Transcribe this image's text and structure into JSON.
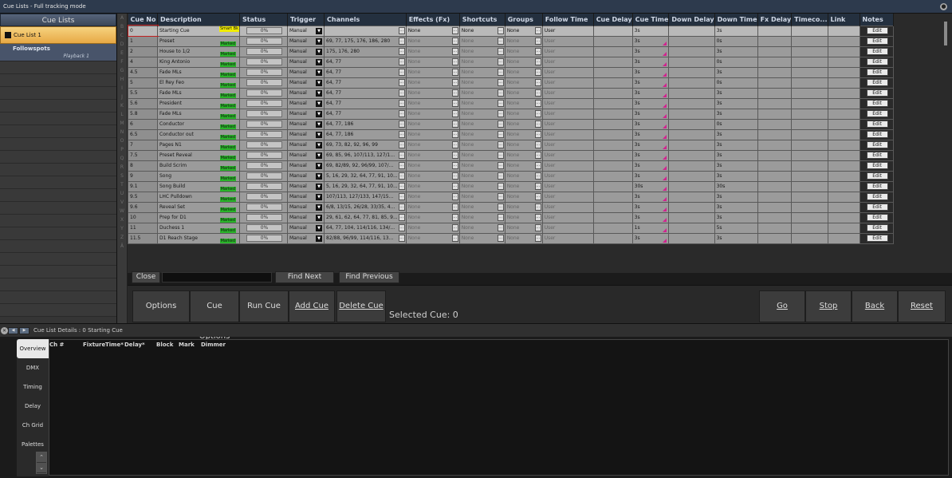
{
  "window": {
    "title": "Cue Lists - Full tracking mode"
  },
  "left": {
    "header": "Cue Lists",
    "items": [
      {
        "label": "Cue List 1"
      },
      {
        "label": "Followspots",
        "sub": "Playback 1"
      }
    ]
  },
  "alpha_letters": [
    "A",
    "B",
    "C",
    "D",
    "E",
    "F",
    "G",
    "H",
    "I",
    "J",
    "K",
    "L",
    "M",
    "N",
    "O",
    "P",
    "Q",
    "R",
    "S",
    "T",
    "U",
    "V",
    "W",
    "X",
    "Y",
    "Z",
    "Ä"
  ],
  "table": {
    "headers": [
      "Cue No",
      "Description",
      "Status",
      "Trigger",
      "Channels",
      "Effects (Fx)",
      "Shortcuts",
      "Groups",
      "Follow Time",
      "Cue Delay",
      "Cue Time",
      "Down Delay",
      "Down Time",
      "Fx Delay",
      "Timeco...",
      "Link",
      "Notes"
    ],
    "rows": [
      {
        "cue": "0",
        "desc": "Starting Cue",
        "badge": "Smart Bk",
        "status": "0%",
        "trigger": "Manual",
        "channels": "",
        "fx": "None",
        "shortcuts": "None",
        "groups": "None",
        "follow": "User",
        "cue_time": "3s",
        "down_time": "3s",
        "notes": "Edit"
      },
      {
        "cue": "1",
        "desc": "Preset",
        "badge": "Marked",
        "status": "0%",
        "trigger": "Manual",
        "channels": "69, 77, 175, 176, 186, 280",
        "fx": "None",
        "shortcuts": "None",
        "groups": "None",
        "follow": "User",
        "cue_time": "3s",
        "down_time": "0s",
        "notes": "Edit"
      },
      {
        "cue": "2",
        "desc": "House to 1/2",
        "badge": "Marked",
        "status": "0%",
        "trigger": "Manual",
        "channels": "175, 176, 280",
        "fx": "None",
        "shortcuts": "None",
        "groups": "None",
        "follow": "User",
        "cue_time": "3s",
        "down_time": "3s",
        "notes": "Edit"
      },
      {
        "cue": "4",
        "desc": "King Antonio",
        "badge": "Marked",
        "status": "0%",
        "trigger": "Manual",
        "channels": "64, 77",
        "fx": "None",
        "shortcuts": "None",
        "groups": "None",
        "follow": "User",
        "cue_time": "3s",
        "down_time": "0s",
        "notes": "Edit"
      },
      {
        "cue": "4.5",
        "desc": "Fade MLs",
        "badge": "Marked",
        "status": "0%",
        "trigger": "Manual",
        "channels": "64, 77",
        "fx": "None",
        "shortcuts": "None",
        "groups": "None",
        "follow": "User",
        "cue_time": "3s",
        "down_time": "3s",
        "notes": "Edit"
      },
      {
        "cue": "5",
        "desc": "El Rey Feo",
        "badge": "Marked",
        "status": "0%",
        "trigger": "Manual",
        "channels": "64, 77",
        "fx": "None",
        "shortcuts": "None",
        "groups": "None",
        "follow": "User",
        "cue_time": "3s",
        "down_time": "0s",
        "notes": "Edit"
      },
      {
        "cue": "5.5",
        "desc": "Fade MLs",
        "badge": "Marked",
        "status": "0%",
        "trigger": "Manual",
        "channels": "64, 77",
        "fx": "None",
        "shortcuts": "None",
        "groups": "None",
        "follow": "User",
        "cue_time": "3s",
        "down_time": "3s",
        "notes": "Edit"
      },
      {
        "cue": "5.6",
        "desc": "President",
        "badge": "Marked",
        "status": "0%",
        "trigger": "Manual",
        "channels": "64, 77",
        "fx": "None",
        "shortcuts": "None",
        "groups": "None",
        "follow": "User",
        "cue_time": "3s",
        "down_time": "3s",
        "notes": "Edit"
      },
      {
        "cue": "5.8",
        "desc": "Fade MLs",
        "badge": "Marked",
        "status": "0%",
        "trigger": "Manual",
        "channels": "64, 77",
        "fx": "None",
        "shortcuts": "None",
        "groups": "None",
        "follow": "User",
        "cue_time": "3s",
        "down_time": "3s",
        "notes": "Edit"
      },
      {
        "cue": "6",
        "desc": "Conductor",
        "badge": "Marked",
        "status": "0%",
        "trigger": "Manual",
        "channels": "64, 77, 186",
        "fx": "None",
        "shortcuts": "None",
        "groups": "None",
        "follow": "User",
        "cue_time": "3s",
        "down_time": "0s",
        "notes": "Edit"
      },
      {
        "cue": "6.5",
        "desc": "Conductor out",
        "badge": "Marked",
        "status": "0%",
        "trigger": "Manual",
        "channels": "64, 77, 186",
        "fx": "None",
        "shortcuts": "None",
        "groups": "None",
        "follow": "User",
        "cue_time": "3s",
        "down_time": "3s",
        "notes": "Edit"
      },
      {
        "cue": "7",
        "desc": "Pages N1",
        "badge": "Marked",
        "status": "0%",
        "trigger": "Manual",
        "channels": "69, 73, 82, 92, 96, 99",
        "fx": "None",
        "shortcuts": "None",
        "groups": "None",
        "follow": "User",
        "cue_time": "3s",
        "down_time": "3s",
        "notes": "Edit"
      },
      {
        "cue": "7.5",
        "desc": "Preset Reveal",
        "badge": "Marked",
        "status": "0%",
        "trigger": "Manual",
        "channels": "69, 85, 96, 107/113, 127/1...",
        "fx": "None",
        "shortcuts": "None",
        "groups": "None",
        "follow": "User",
        "cue_time": "3s",
        "down_time": "3s",
        "notes": "Edit"
      },
      {
        "cue": "8",
        "desc": "Build Scrim",
        "badge": "Marked",
        "status": "0%",
        "trigger": "Manual",
        "channels": "69, 82/89, 92, 96/99, 107/...",
        "fx": "None",
        "shortcuts": "None",
        "groups": "None",
        "follow": "User",
        "cue_time": "3s",
        "down_time": "3s",
        "notes": "Edit"
      },
      {
        "cue": "9",
        "desc": "Song",
        "badge": "Marked",
        "status": "0%",
        "trigger": "Manual",
        "channels": "5, 16, 29, 32, 64, 77, 91, 10...",
        "fx": "None",
        "shortcuts": "None",
        "groups": "None",
        "follow": "User",
        "cue_time": "3s",
        "down_time": "3s",
        "notes": "Edit"
      },
      {
        "cue": "9.1",
        "desc": "Song Build",
        "badge": "Marked",
        "status": "0%",
        "trigger": "Manual",
        "channels": "5, 16, 29, 32, 64, 77, 91, 10...",
        "fx": "None",
        "shortcuts": "None",
        "groups": "None",
        "follow": "User",
        "cue_time": "30s",
        "down_time": "30s",
        "notes": "Edit"
      },
      {
        "cue": "9.5",
        "desc": "LHC Pulldown",
        "badge": "Marked",
        "status": "0%",
        "trigger": "Manual",
        "channels": "107/113, 127/133, 147/15...",
        "fx": "None",
        "shortcuts": "None",
        "groups": "None",
        "follow": "User",
        "cue_time": "3s",
        "down_time": "3s",
        "notes": "Edit"
      },
      {
        "cue": "9.6",
        "desc": "Reveal Set",
        "badge": "Marked",
        "status": "0%",
        "trigger": "Manual",
        "channels": "6/8, 13/15, 26/28, 33/35, 4...",
        "fx": "None",
        "shortcuts": "None",
        "groups": "None",
        "follow": "User",
        "cue_time": "3s",
        "down_time": "3s",
        "notes": "Edit"
      },
      {
        "cue": "10",
        "desc": "Prep for D1",
        "badge": "Marked",
        "status": "0%",
        "trigger": "Manual",
        "channels": "29, 61, 62, 64, 77, 81, 85, 9...",
        "fx": "None",
        "shortcuts": "None",
        "groups": "None",
        "follow": "User",
        "cue_time": "3s",
        "down_time": "3s",
        "notes": "Edit"
      },
      {
        "cue": "11",
        "desc": "Duchess 1",
        "badge": "Marked",
        "status": "0%",
        "trigger": "Manual",
        "channels": "64, 77, 104, 114/116, 134/...",
        "fx": "None",
        "shortcuts": "None",
        "groups": "None",
        "follow": "User",
        "cue_time": "1s",
        "down_time": "5s",
        "notes": "Edit"
      },
      {
        "cue": "11.5",
        "desc": "D1 Reach Stage",
        "badge": "Marked",
        "status": "0%",
        "trigger": "Manual",
        "channels": "82/88, 96/99, 114/116, 13...",
        "fx": "None",
        "shortcuts": "None",
        "groups": "None",
        "follow": "User",
        "cue_time": "3s",
        "down_time": "3s",
        "notes": "Edit"
      }
    ]
  },
  "find": {
    "close": "Close",
    "next": "Find Next",
    "previous": "Find Previous"
  },
  "buttons": {
    "options": "Options",
    "cue_options": "Cue Options",
    "run_cue": "Run Cue",
    "add_cue": "Add Cue",
    "delete_cue": "Delete Cue",
    "selected_cue": "Selected Cue: 0",
    "go": "Go",
    "stop": "Stop",
    "back": "Back",
    "reset": "Reset"
  },
  "details": {
    "title": "Cue List Details : 0 Starting Cue",
    "tabs": [
      "Overview",
      "DMX",
      "Timing",
      "Delay",
      "Ch Grid",
      "Palettes"
    ],
    "columns": [
      "Ch #",
      "Fixture",
      "Time*",
      "Delay*",
      "Block",
      "Mark",
      "Dimmer"
    ]
  },
  "colors": {
    "selected_list": "#f0c060",
    "marked": "#2ab52a",
    "smart_bk": "#f1ec00",
    "marker": "#d1238f"
  }
}
